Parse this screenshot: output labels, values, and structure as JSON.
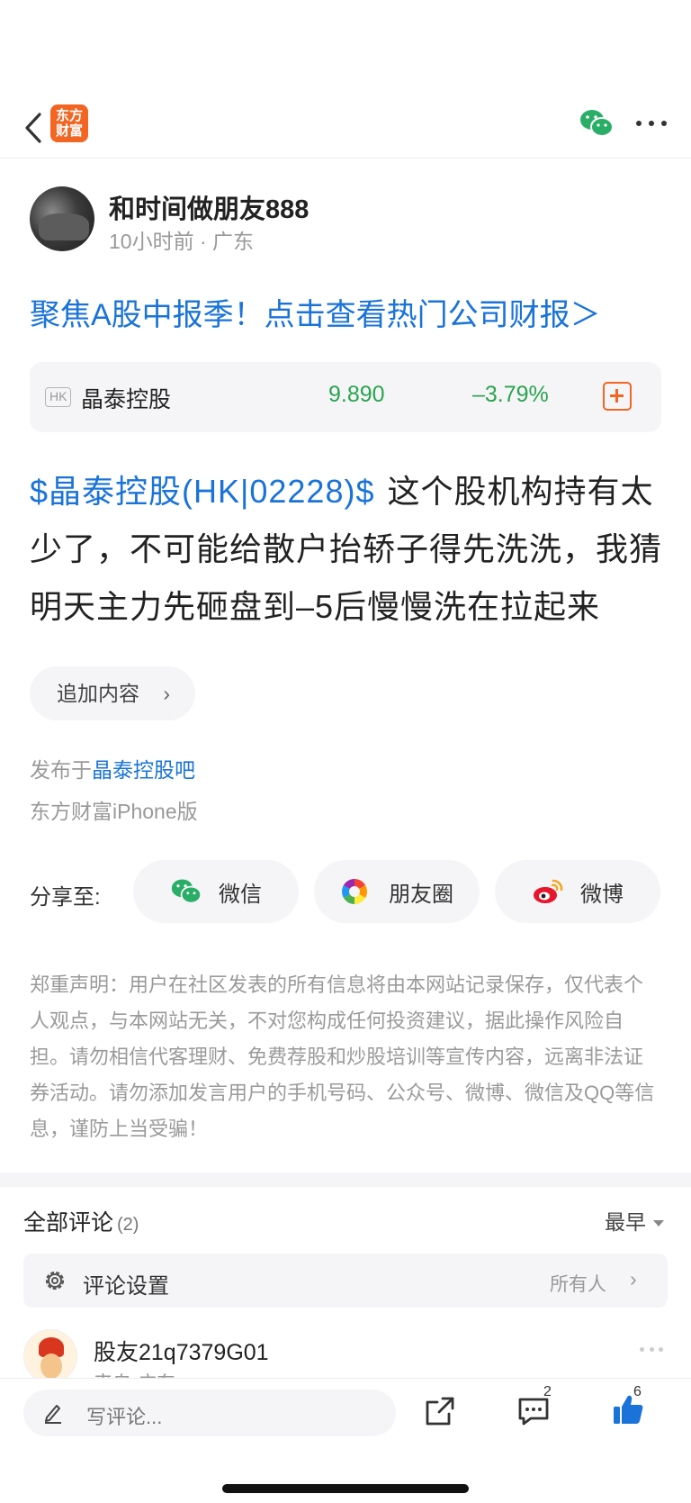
{
  "header": {
    "logo_text": "东方财富",
    "brand_color": "#f26522",
    "wechat_color": "#2aae67"
  },
  "author": {
    "name": "和时间做朋友888",
    "meta": "10小时前 · 广东"
  },
  "promo": {
    "text": "聚焦A股中报季！点击查看热门公司财报＞",
    "color": "#1a73d9"
  },
  "stock": {
    "market_badge": "HK",
    "name": "晶泰控股",
    "price": "9.890",
    "change": "–3.79%",
    "change_color": "#2aa44f"
  },
  "post": {
    "tag": "$晶泰控股(HK|02228)$",
    "body": "这个股机构持有太少了，不可能给散户抬轿子得先洗洗，我猜明天主力先砸盘到–5后慢慢洗在拉起来"
  },
  "append_button": {
    "label": "追加内容"
  },
  "publish_info": {
    "prefix": "发布于",
    "forum": "晶泰控股吧",
    "client": "东方财富iPhone版"
  },
  "share": {
    "label": "分享至:",
    "targets": [
      "微信",
      "朋友圈",
      "微博"
    ]
  },
  "disclaimer": "郑重声明：用户在社区发表的所有信息将由本网站记录保存，仅代表个人观点，与本网站无关，不对您构成任何投资建议，据此操作风险自担。请勿相信代客理财、免费荐股和炒股培训等宣传内容，远离非法证券活动。请勿添加发言用户的手机号码、公众号、微博、微信及QQ等信息，谨防上当受骗！",
  "comments": {
    "title": "全部评论",
    "count": "(2)",
    "sort_label": "最早",
    "settings": {
      "label": "评论设置",
      "value": "所有人"
    },
    "items": [
      {
        "user": "股友21q7379G01",
        "meta": "来自·广东"
      }
    ]
  },
  "bottom_bar": {
    "placeholder": "写评论...",
    "comment_count": "2",
    "like_count": "6",
    "like_color": "#1a73d9"
  }
}
